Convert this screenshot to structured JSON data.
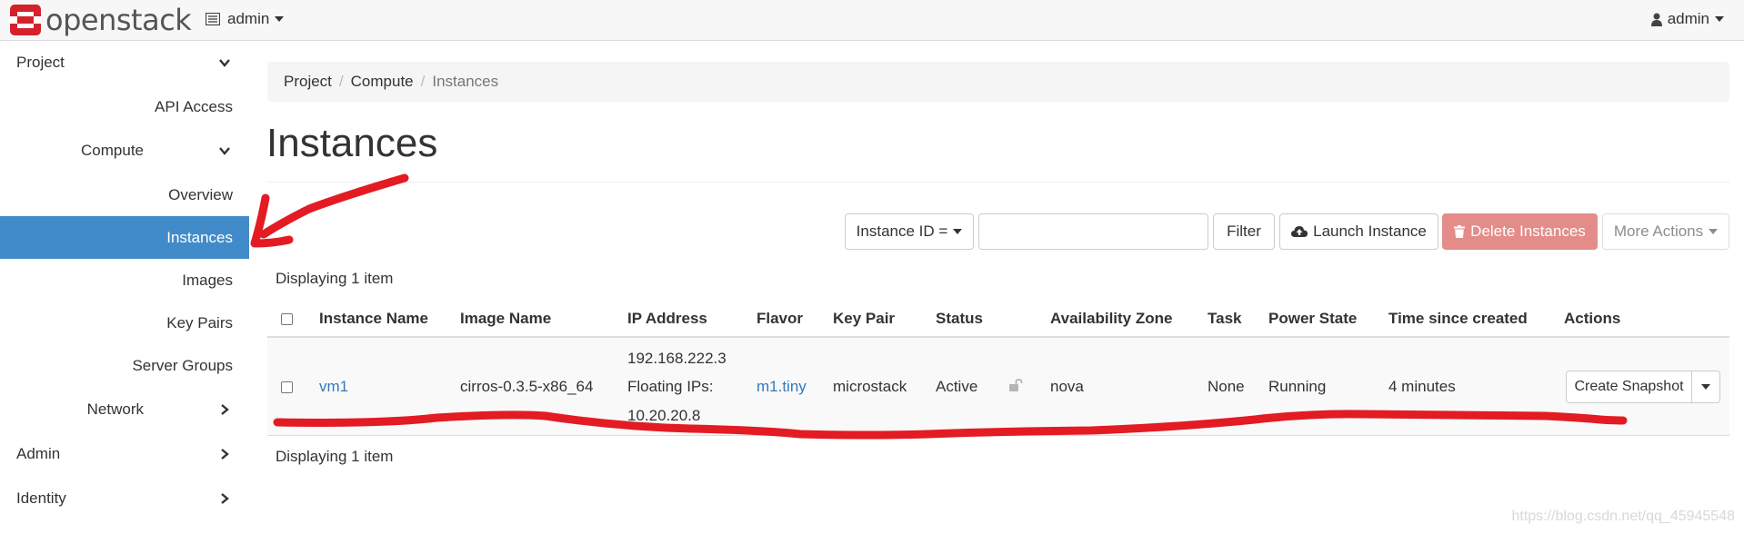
{
  "navbar": {
    "brand": "openstack",
    "project_name": "admin",
    "user_name": "admin"
  },
  "sidebar": {
    "project": "Project",
    "api_access": "API Access",
    "compute": "Compute",
    "overview": "Overview",
    "instances": "Instances",
    "images": "Images",
    "key_pairs": "Key Pairs",
    "server_groups": "Server Groups",
    "network": "Network",
    "admin": "Admin",
    "identity": "Identity"
  },
  "breadcrumb": [
    "Project",
    "Compute",
    "Instances"
  ],
  "page": {
    "title": "Instances",
    "count_top": "Displaying 1 item",
    "count_bottom": "Displaying 1 item"
  },
  "toolbar": {
    "filter_field": "Instance ID =",
    "filter_placeholder": "",
    "filter_button": "Filter",
    "launch_button": "Launch Instance",
    "delete_button": "Delete Instances",
    "more_actions": "More Actions"
  },
  "table": {
    "columns": [
      "Instance Name",
      "Image Name",
      "IP Address",
      "Flavor",
      "Key Pair",
      "Status",
      "Availability Zone",
      "Task",
      "Power State",
      "Time since created",
      "Actions"
    ],
    "rows": [
      {
        "instance_name": "vm1",
        "image_name": "cirros-0.3.5-x86_64",
        "ip_line1": "192.168.222.3",
        "ip_line2": "Floating IPs:",
        "ip_line3": "10.20.20.8",
        "flavor": "m1.tiny",
        "key_pair": "microstack",
        "status": "Active",
        "availability_zone": "nova",
        "task": "None",
        "power_state": "Running",
        "time_since_created": "4 minutes",
        "action": "Create Snapshot"
      }
    ]
  },
  "watermark": "https://blog.csdn.net/qq_45945548",
  "colors": {
    "active_nav": "#428bca",
    "link": "#337ab7",
    "danger_button": "#e48c8a",
    "annotation": "#e31b23",
    "logo": "#d4212b"
  }
}
